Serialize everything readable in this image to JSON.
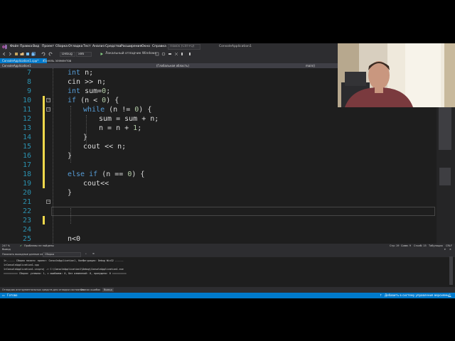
{
  "menu": {
    "items": [
      "Файл",
      "Правка",
      "Вид",
      "Проект",
      "Сборка",
      "Отладка",
      "Тест",
      "Анализ",
      "Средства",
      "Расширения",
      "Окно",
      "Справка"
    ],
    "quick_launch_placeholder": "Поиск (Ctrl+Q)",
    "solution_name": "ConsoleApplication1"
  },
  "toolbar": {
    "configuration": "Debug",
    "platform": "x86",
    "run_label": "Локальный отладчик Windows"
  },
  "tabs": [
    {
      "label": "ConsoleApplication1.cpp*",
      "active": true
    },
    {
      "label": "Панель элементов",
      "active": false
    }
  ],
  "navbar": {
    "project": "ConsoleApplication1",
    "scope": "(Глобальная область)",
    "function": "main()"
  },
  "editor": {
    "lines": [
      {
        "n": "7",
        "code": "int n;"
      },
      {
        "n": "8",
        "code": "cin >> n;"
      },
      {
        "n": "9",
        "code": "int sum=0;"
      },
      {
        "n": "10",
        "code": "if (n < 0) {"
      },
      {
        "n": "11",
        "code": "while (n != 0) {"
      },
      {
        "n": "12",
        "code": "sum = sum + n;"
      },
      {
        "n": "13",
        "code": "n = n + 1;"
      },
      {
        "n": "14",
        "code": "}"
      },
      {
        "n": "15",
        "code": "cout << n;"
      },
      {
        "n": "16",
        "code": "}"
      },
      {
        "n": "17",
        "code": ""
      },
      {
        "n": "18",
        "code": "else if (n == 0) {"
      },
      {
        "n": "19",
        "code": "cout<<"
      },
      {
        "n": "20",
        "code": "}"
      },
      {
        "n": "21",
        "code": ""
      },
      {
        "n": "22",
        "code": ""
      },
      {
        "n": "23",
        "code": ""
      },
      {
        "n": "24",
        "code": ""
      },
      {
        "n": "25",
        "code": "n<0"
      }
    ]
  },
  "editor_status": {
    "zoom": "247 %",
    "no_issues": "Проблемы не найдены",
    "line": "Стр: 19",
    "char": "Симв: 9",
    "col": "Столб: 15",
    "mode": "Табуляция",
    "eol": "CRLF"
  },
  "output": {
    "title": "Вывод",
    "show_from_label": "Показать выходные данные из:",
    "show_from_value": "Сборка",
    "lines": [
      "1>------ Сборка начата: проект: ConsoleApplication1, Конфигурация: Debug Win32 ------",
      "1>ConsoleApplication1.cpp",
      "1>ConsoleApplication1.vcxproj -> C:\\ConsoleApplication1\\Debug\\ConsoleApplication1.exe",
      "========== Сборка: успешно: 1, с ошибками: 0, без изменений: 0, пропущено: 0 =========="
    ]
  },
  "bottom_tabs": [
    "Отладчик инструментальных средств для отладки состояния",
    "Список ошибок",
    "Вывод"
  ],
  "status": {
    "ready": "Готово",
    "source_control": "Добавить в систему управления версиями"
  }
}
